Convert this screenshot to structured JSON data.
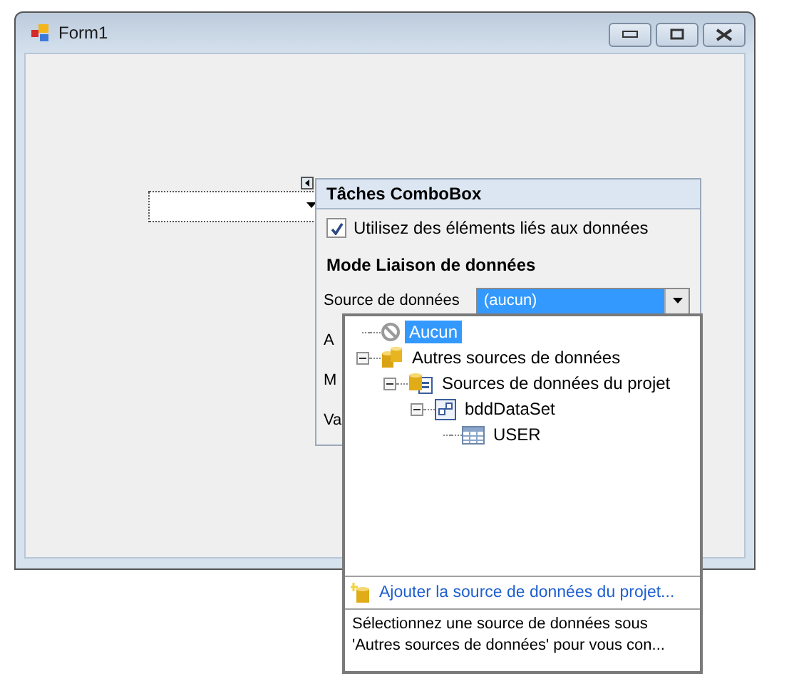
{
  "window": {
    "title": "Form1"
  },
  "smart_tag_panel": {
    "title": "Tâches ComboBox",
    "bound_checkbox": {
      "label": "Utilisez des éléments liés aux données",
      "checked": true
    },
    "section_title": "Mode Liaison de données",
    "fields": [
      {
        "label": "Source de données",
        "value": "(aucun)"
      },
      {
        "label": "A"
      },
      {
        "label": "M"
      },
      {
        "label": "Va"
      }
    ]
  },
  "dropdown": {
    "tree": [
      {
        "label": "Aucun",
        "kind": "none",
        "selected": true
      },
      {
        "label": "Autres sources de données",
        "kind": "databases",
        "selected": false,
        "expanded": true,
        "children": [
          {
            "label": "Sources de données du projet",
            "kind": "project",
            "selected": false,
            "expanded": true,
            "children": [
              {
                "label": "bddDataSet",
                "kind": "dataset",
                "selected": false,
                "expanded": true,
                "children": [
                  {
                    "label": "USER",
                    "kind": "table",
                    "selected": false
                  }
                ]
              }
            ]
          }
        ]
      }
    ],
    "link": "Ajouter la source de données du projet...",
    "description": "Sélectionnez une source de données sous\n'Autres sources de données' pour vous con..."
  }
}
